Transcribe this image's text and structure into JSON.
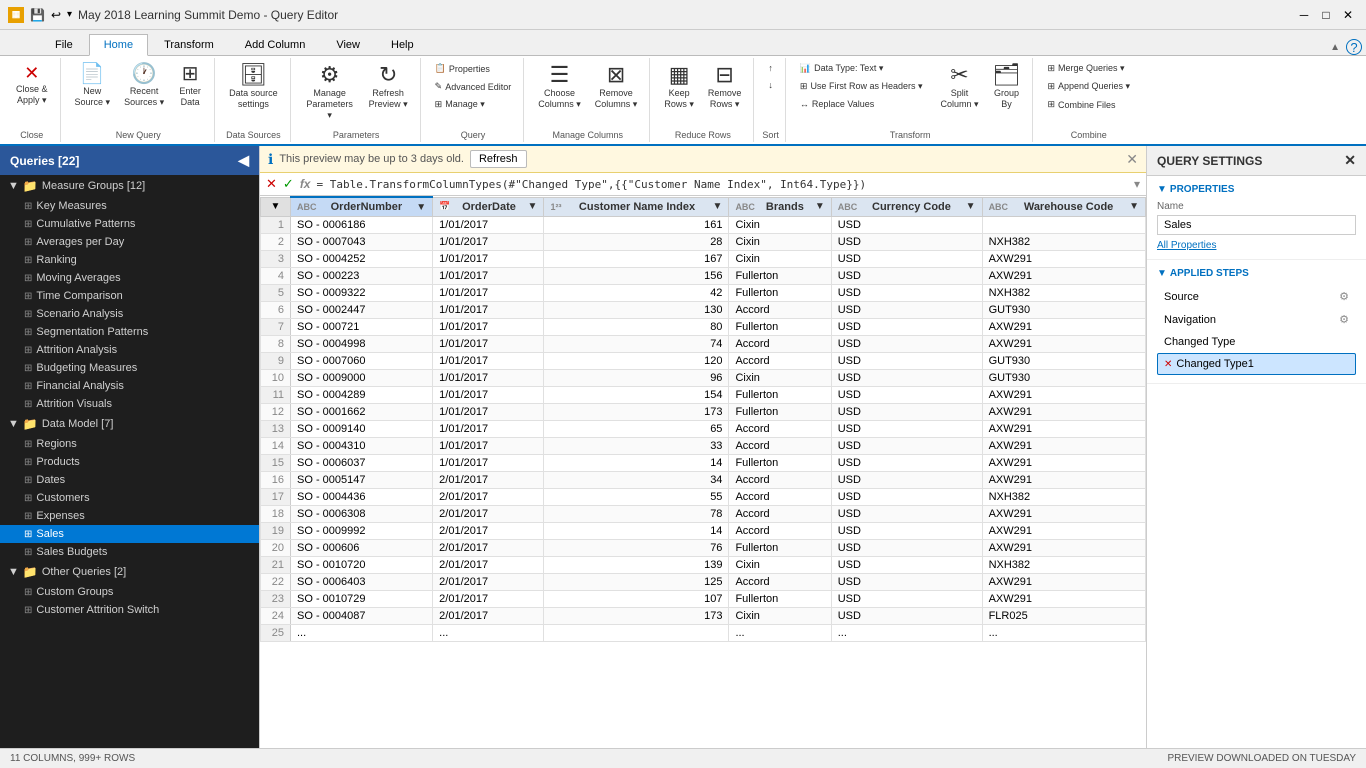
{
  "titleBar": {
    "icon": "▦",
    "title": "May 2018 Learning Summit Demo - Query Editor",
    "controls": [
      "─",
      "□",
      "✕"
    ]
  },
  "ribbonTabs": [
    {
      "label": "File",
      "active": false
    },
    {
      "label": "Home",
      "active": true
    },
    {
      "label": "Transform",
      "active": false
    },
    {
      "label": "Add Column",
      "active": false
    },
    {
      "label": "View",
      "active": false
    },
    {
      "label": "Help",
      "active": false
    }
  ],
  "ribbonGroups": [
    {
      "name": "close",
      "label": "Close",
      "buttons": [
        {
          "icon": "✕",
          "label": "Close &\nApply",
          "arrow": true
        }
      ]
    },
    {
      "name": "new-query",
      "label": "New Query",
      "buttons": [
        {
          "icon": "📄",
          "label": "New\nSource",
          "arrow": true
        },
        {
          "icon": "🕐",
          "label": "Recent\nSources",
          "arrow": true
        },
        {
          "icon": "⊞",
          "label": "Enter\nData"
        }
      ]
    },
    {
      "name": "data-sources",
      "label": "Data Sources",
      "buttons": [
        {
          "icon": "🗄",
          "label": "Data source\nsettings"
        }
      ]
    },
    {
      "name": "parameters",
      "label": "Parameters",
      "buttons": [
        {
          "icon": "⚙",
          "label": "Manage\nParameters",
          "arrow": true
        },
        {
          "icon": "↻",
          "label": "Refresh\nPreview",
          "arrow": true
        }
      ]
    },
    {
      "name": "query",
      "label": "Query",
      "stackButtons": [
        {
          "icon": "📋",
          "label": "Properties"
        },
        {
          "icon": "✎",
          "label": "Advanced Editor"
        },
        {
          "icon": "⊞",
          "label": "Manage ▾"
        }
      ],
      "buttons": []
    },
    {
      "name": "manage-columns",
      "label": "Manage Columns",
      "buttons": [
        {
          "icon": "☰",
          "label": "Choose\nColumns",
          "arrow": true
        },
        {
          "icon": "⊠",
          "label": "Remove\nColumns",
          "arrow": true
        }
      ]
    },
    {
      "name": "reduce-rows",
      "label": "Reduce Rows",
      "buttons": [
        {
          "icon": "▦",
          "label": "Keep\nRows",
          "arrow": true
        },
        {
          "icon": "⊟",
          "label": "Remove\nRows",
          "arrow": true
        }
      ]
    },
    {
      "name": "sort",
      "label": "Sort",
      "buttons": [
        {
          "icon": "↑",
          "label": ""
        },
        {
          "icon": "↓",
          "label": ""
        }
      ]
    },
    {
      "name": "transform",
      "label": "Transform",
      "stackButtons": [
        {
          "icon": "📊",
          "label": "Data Type: Text ▾"
        },
        {
          "icon": "⊞",
          "label": "Use First Row as Headers ▾"
        },
        {
          "icon": "↔",
          "label": "Replace Values"
        }
      ],
      "buttons": [
        {
          "icon": "✂",
          "label": "Split\nColumn",
          "arrow": true
        },
        {
          "icon": "🗂",
          "label": "Group\nBy"
        }
      ]
    },
    {
      "name": "combine",
      "label": "Combine",
      "stackButtons": [
        {
          "icon": "⊞",
          "label": "Merge Queries ▾"
        },
        {
          "icon": "⊞",
          "label": "Append Queries ▾"
        },
        {
          "icon": "⊞",
          "label": "Combine Files"
        }
      ]
    }
  ],
  "infoBanner": {
    "message": "This preview may be up to 3 days old.",
    "refreshLabel": "Refresh"
  },
  "formulaBar": {
    "value": "= Table.TransformColumnTypes(#\"Changed Type\",{{\"Customer Name Index\", Int64.Type}})"
  },
  "columns": [
    {
      "name": "OrderNumber",
      "type": "ABC",
      "active": true
    },
    {
      "name": "OrderDate",
      "type": "📅"
    },
    {
      "name": "Customer Name Index",
      "type": "123"
    },
    {
      "name": "Brands",
      "type": "ABC"
    },
    {
      "name": "Currency Code",
      "type": "ABC"
    },
    {
      "name": "Warehouse Code",
      "type": "ABC"
    }
  ],
  "tableData": [
    [
      1,
      "SO - 0006186",
      "1/01/2017",
      161,
      "Cixin",
      "USD",
      ""
    ],
    [
      2,
      "SO - 0007043",
      "1/01/2017",
      28,
      "Cixin",
      "USD",
      "NXH382"
    ],
    [
      3,
      "SO - 0004252",
      "1/01/2017",
      167,
      "Cixin",
      "USD",
      "AXW291"
    ],
    [
      4,
      "SO - 000223",
      "1/01/2017",
      156,
      "Fullerton",
      "USD",
      "AXW291"
    ],
    [
      5,
      "SO - 0009322",
      "1/01/2017",
      42,
      "Fullerton",
      "USD",
      "NXH382"
    ],
    [
      6,
      "SO - 0002447",
      "1/01/2017",
      130,
      "Accord",
      "USD",
      "GUT930"
    ],
    [
      7,
      "SO - 000721",
      "1/01/2017",
      80,
      "Fullerton",
      "USD",
      "AXW291"
    ],
    [
      8,
      "SO - 0004998",
      "1/01/2017",
      74,
      "Accord",
      "USD",
      "AXW291"
    ],
    [
      9,
      "SO - 0007060",
      "1/01/2017",
      120,
      "Accord",
      "USD",
      "GUT930"
    ],
    [
      10,
      "SO - 0009000",
      "1/01/2017",
      96,
      "Cixin",
      "USD",
      "GUT930"
    ],
    [
      11,
      "SO - 0004289",
      "1/01/2017",
      154,
      "Fullerton",
      "USD",
      "AXW291"
    ],
    [
      12,
      "SO - 0001662",
      "1/01/2017",
      173,
      "Fullerton",
      "USD",
      "AXW291"
    ],
    [
      13,
      "SO - 0009140",
      "1/01/2017",
      65,
      "Accord",
      "USD",
      "AXW291"
    ],
    [
      14,
      "SO - 0004310",
      "1/01/2017",
      33,
      "Accord",
      "USD",
      "AXW291"
    ],
    [
      15,
      "SO - 0006037",
      "1/01/2017",
      14,
      "Fullerton",
      "USD",
      "AXW291"
    ],
    [
      16,
      "SO - 0005147",
      "2/01/2017",
      34,
      "Accord",
      "USD",
      "AXW291"
    ],
    [
      17,
      "SO - 0004436",
      "2/01/2017",
      55,
      "Accord",
      "USD",
      "NXH382"
    ],
    [
      18,
      "SO - 0006308",
      "2/01/2017",
      78,
      "Accord",
      "USD",
      "AXW291"
    ],
    [
      19,
      "SO - 0009992",
      "2/01/2017",
      14,
      "Accord",
      "USD",
      "AXW291"
    ],
    [
      20,
      "SO - 000606",
      "2/01/2017",
      76,
      "Fullerton",
      "USD",
      "AXW291"
    ],
    [
      21,
      "SO - 0010720",
      "2/01/2017",
      139,
      "Cixin",
      "USD",
      "NXH382"
    ],
    [
      22,
      "SO - 0006403",
      "2/01/2017",
      125,
      "Accord",
      "USD",
      "AXW291"
    ],
    [
      23,
      "SO - 0010729",
      "2/01/2017",
      107,
      "Fullerton",
      "USD",
      "AXW291"
    ],
    [
      24,
      "SO - 0004087",
      "2/01/2017",
      173,
      "Cixin",
      "USD",
      "FLR025"
    ],
    [
      25,
      "...",
      "...",
      "",
      "...",
      "...",
      "..."
    ]
  ],
  "sidebar": {
    "title": "Queries [22]",
    "groups": [
      {
        "name": "Measure Groups",
        "label": "Measure Groups [12]",
        "items": [
          "Key Measures",
          "Cumulative Patterns",
          "Averages per Day",
          "Ranking",
          "Moving Averages",
          "Time Comparison",
          "Scenario Analysis",
          "Segmentation Patterns",
          "Attrition Analysis",
          "Budgeting Measures",
          "Financial Analysis",
          "Attrition Visuals"
        ]
      },
      {
        "name": "Data Model",
        "label": "Data Model [7]",
        "items": [
          "Regions",
          "Products",
          "Dates",
          "Customers",
          "Expenses",
          "Sales",
          "Sales Budgets"
        ]
      },
      {
        "name": "Other Queries",
        "label": "Other Queries [2]",
        "items": [
          "Custom Groups",
          "Customer Attrition Switch"
        ]
      }
    ],
    "activeItem": "Sales"
  },
  "querySettings": {
    "title": "QUERY SETTINGS",
    "propertiesTitle": "PROPERTIES",
    "nameLabel": "Name",
    "nameValue": "Sales",
    "allPropertiesLink": "All Properties",
    "stepsTitle": "APPLIED STEPS",
    "steps": [
      {
        "label": "Source",
        "gear": true,
        "error": false
      },
      {
        "label": "Navigation",
        "gear": true,
        "error": false
      },
      {
        "label": "Changed Type",
        "gear": false,
        "error": false
      },
      {
        "label": "Changed Type1",
        "gear": false,
        "error": true,
        "active": true
      }
    ]
  },
  "statusBar": {
    "rowInfo": "11 COLUMNS, 999+ ROWS",
    "downloadInfo": "PREVIEW DOWNLOADED ON TUESDAY"
  }
}
